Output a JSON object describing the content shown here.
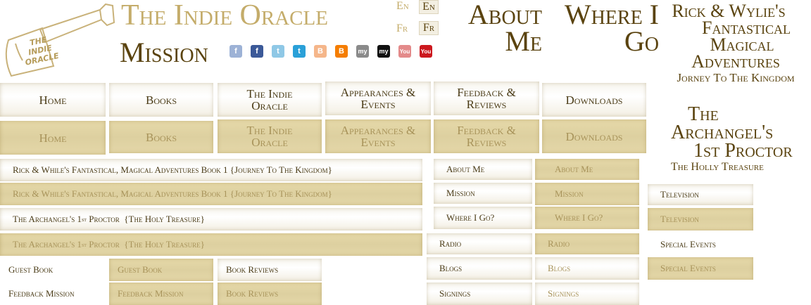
{
  "header": {
    "site_title": "The Indie Oracle",
    "logo_text": "THE INDIE ORACLE",
    "mission": "Mission",
    "lang": {
      "en_plain": "En",
      "en_boxed": "En",
      "fr_plain": "Fr",
      "fr_boxed": "Fr"
    },
    "about_me": "About Me",
    "where_i_go": "Where I Go"
  },
  "social": [
    {
      "icon": "facebook-icon",
      "label": "f",
      "color": "#9db2d6"
    },
    {
      "icon": "facebook-icon",
      "label": "f",
      "color": "#3b5998"
    },
    {
      "icon": "twitter-icon",
      "label": "t",
      "color": "#8fc8e6"
    },
    {
      "icon": "twitter-icon",
      "label": "t",
      "color": "#2aa0d8"
    },
    {
      "icon": "blogger-icon",
      "label": "B",
      "color": "#f5b68a"
    },
    {
      "icon": "blogger-icon",
      "label": "B",
      "color": "#f57d00"
    },
    {
      "icon": "myspace-icon",
      "label": "my",
      "color": "#8a8a8a"
    },
    {
      "icon": "myspace-icon",
      "label": "my",
      "color": "#111111"
    },
    {
      "icon": "youtube-icon",
      "label": "You",
      "color": "#e38a8a"
    },
    {
      "icon": "youtube-icon",
      "label": "You",
      "color": "#cc181e"
    }
  ],
  "nav": [
    "Home",
    "Books",
    "The Indie Oracle",
    "Appearances & Events",
    "Feedback & Reviews",
    "Downloads"
  ],
  "books": {
    "book1": "Rick & While's Fantastical, Magical Adventures Book 1  {Journey To The Kingdom}",
    "book2_a": "The Archangel's 1",
    "book2_sup": "st",
    "book2_b": " Proctor  {The Holy Treasure}"
  },
  "misc": {
    "guest_book": "Guest Book",
    "book_reviews": "Book Reviews",
    "feedback_mission": "Feedback Mission"
  },
  "about": {
    "about_me": "About Me",
    "mission": "Mission",
    "where_i_go": "Where I Go?"
  },
  "media": {
    "radio": "Radio",
    "blogs": "Blogs",
    "signings": "Signings",
    "television": "Television",
    "special_events": "Special Events"
  },
  "side": {
    "title1_l1": "Rick & Wylie's",
    "title1_l2": "Fantastical",
    "title1_l3": "Magical",
    "title1_l4": "Adventures",
    "subtitle1": "Jorney To The Kingdom",
    "title2_l1": "The",
    "title2_l2": "Archangel's",
    "title2_l3": "1st Proctor",
    "subtitle2": "The Holly Treasure"
  }
}
